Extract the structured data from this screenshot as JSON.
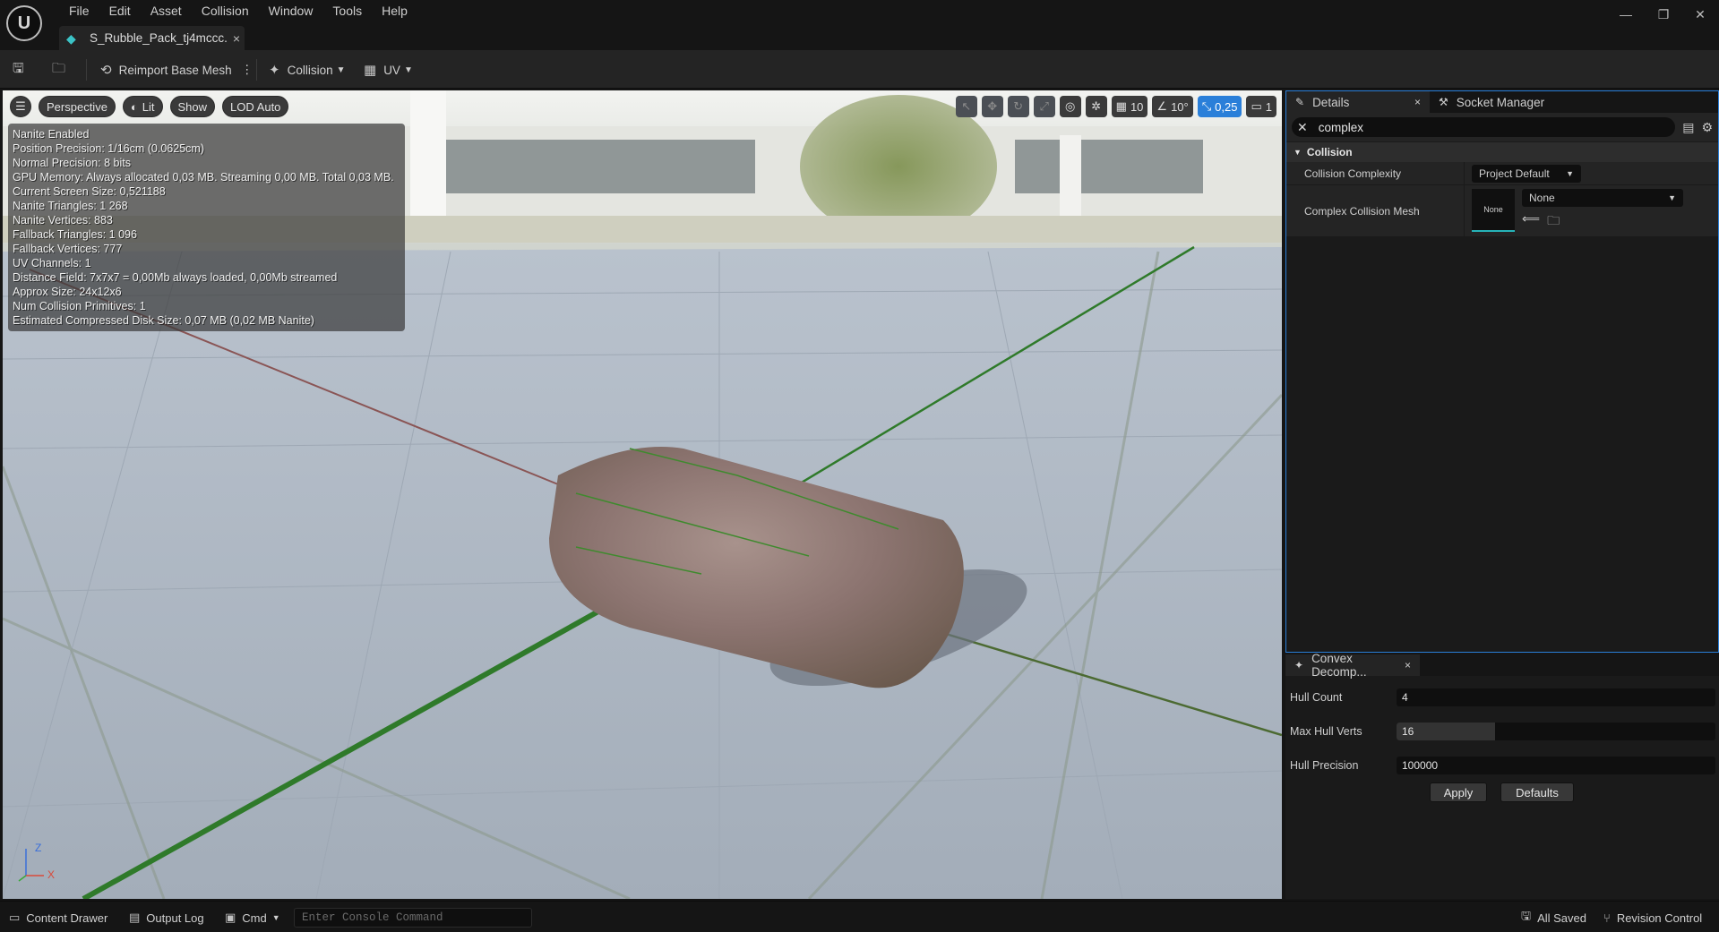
{
  "app": {
    "logo": "U",
    "menu": [
      "File",
      "Edit",
      "Asset",
      "Collision",
      "Window",
      "Tools",
      "Help"
    ],
    "asset_tab": {
      "label": "S_Rubble_Pack_tj4mccc...",
      "close": "×"
    },
    "window_controls": {
      "minimize": "—",
      "restore": "❐",
      "close": "✕"
    }
  },
  "toolbar": {
    "reimport_label": "Reimport Base Mesh",
    "more": "⋮",
    "collision_label": "Collision",
    "uv_label": "UV"
  },
  "viewport": {
    "perspective": "Perspective",
    "lit": "Lit",
    "show": "Show",
    "lod": "LOD Auto",
    "grid_snap": "10",
    "angle_snap": "10°",
    "scale_snap": "0,25",
    "camera_speed": "1",
    "axis": {
      "z": "Z",
      "x": "X"
    },
    "stats": [
      "Nanite Enabled",
      "Position Precision: 1/16cm (0.0625cm)",
      "Normal Precision: 8 bits",
      "GPU Memory: Always allocated 0,03 MB. Streaming 0,00 MB. Total 0,03 MB.",
      "Current Screen Size:  0,521188",
      "Nanite Triangles:  1 268",
      "Nanite Vertices:  883",
      "Fallback Triangles:  1 096",
      "Fallback Vertices:  777",
      "UV Channels:  1",
      "Distance Field:  7x7x7 = 0,00Mb always loaded, 0,00Mb streamed",
      "Approx Size: 24x12x6",
      "Num Collision Primitives:  1",
      "Estimated Compressed Disk Size: 0,07 MB (0,02 MB Nanite)"
    ]
  },
  "details": {
    "tab_label": "Details",
    "tab_close": "×",
    "socket_tab": "Socket Manager",
    "search_value": "complex",
    "category": "Collision",
    "props": {
      "complexity_name": "Collision Complexity",
      "complexity_value": "Project Default",
      "mesh_name": "Complex Collision Mesh",
      "mesh_thumb": "None",
      "mesh_value": "None"
    }
  },
  "convex": {
    "tab_label": "Convex Decomp...",
    "tab_close": "×",
    "hull_count_label": "Hull Count",
    "hull_count": "4",
    "max_hull_verts_label": "Max Hull Verts",
    "max_hull_verts": "16",
    "max_hull_verts_fraction": 0.31,
    "hull_precision_label": "Hull Precision",
    "hull_precision": "100000",
    "apply": "Apply",
    "defaults": "Defaults"
  },
  "status": {
    "content_drawer": "Content Drawer",
    "output_log": "Output Log",
    "cmd": "Cmd",
    "console_placeholder": "Enter Console Command",
    "all_saved": "All Saved",
    "revision": "Revision Control"
  },
  "colors": {
    "accent": "#2a7fd9",
    "teal": "#26b3b8",
    "grid_green": "#2f7a2a"
  }
}
